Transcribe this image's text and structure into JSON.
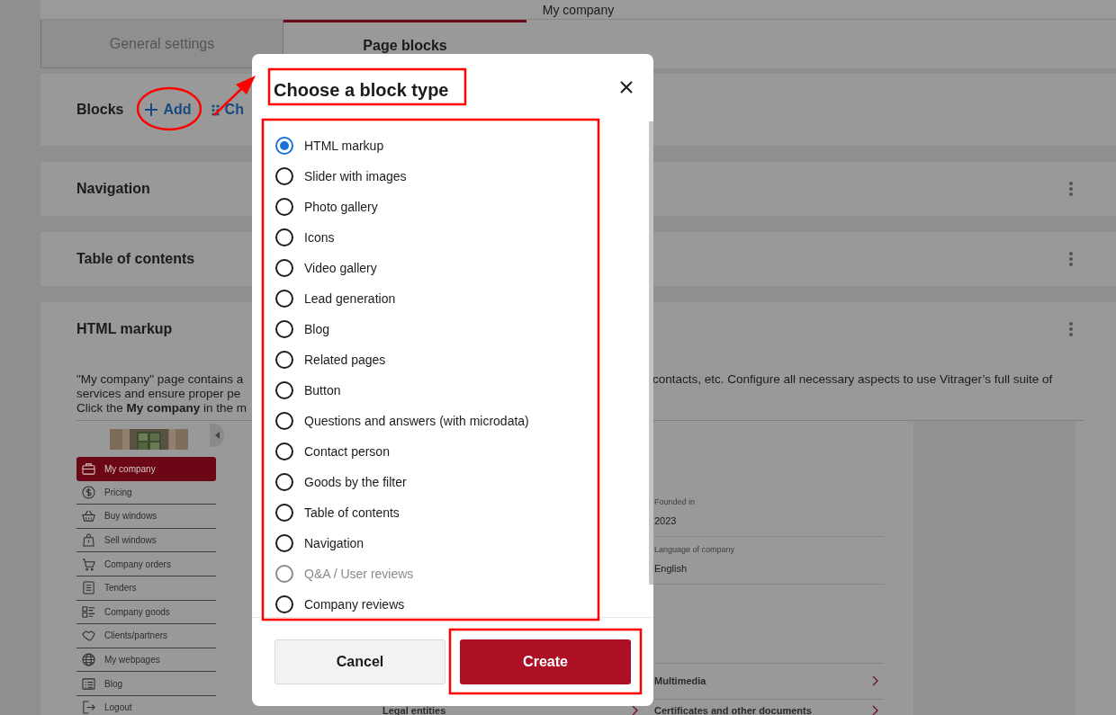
{
  "header": {
    "title": "My company"
  },
  "tabs": [
    {
      "label": "General settings",
      "selected": false
    },
    {
      "label": "Page blocks",
      "selected": true
    }
  ],
  "blocks_toolbar": {
    "title": "Blocks",
    "add_label": "Add",
    "second_action": "Ch"
  },
  "blocks": [
    {
      "title": "Navigation"
    },
    {
      "title": "Table of contents"
    },
    {
      "title": "HTML markup"
    }
  ],
  "html_block": {
    "description_left": [
      "\"My company\" page contains a",
      "services and ensure proper pe",
      "Click the **My company** in the m"
    ],
    "description_right": [
      "contacts, etc. Configure all necessary aspects to use Vitrager’s full suite of"
    ],
    "preview": {
      "menu": [
        {
          "label": "My company",
          "selected": true
        },
        {
          "label": "Pricing",
          "selected": false
        },
        {
          "label": "Buy windows",
          "selected": false
        },
        {
          "label": "Sell windows",
          "selected": false
        },
        {
          "label": "Company orders",
          "selected": false
        },
        {
          "label": "Tenders",
          "selected": false
        },
        {
          "label": "Company goods",
          "selected": false
        },
        {
          "label": "Clients/partners",
          "selected": false
        },
        {
          "label": "My webpages",
          "selected": false
        },
        {
          "label": "Blog",
          "selected": false
        },
        {
          "label": "Logout",
          "selected": false
        }
      ],
      "fields": [
        {
          "label": "Founded in",
          "value": "2023"
        },
        {
          "label": "Language of company",
          "value": "English"
        }
      ],
      "links": [
        {
          "label": "Multimedia"
        },
        {
          "label": "Certificates and other documents"
        }
      ],
      "left_links": [
        {
          "label": "Legal entities"
        }
      ]
    }
  },
  "dialog": {
    "title": "Choose a block type",
    "options": [
      {
        "label": "HTML markup",
        "selected": true,
        "disabled": false
      },
      {
        "label": "Slider with images",
        "selected": false,
        "disabled": false
      },
      {
        "label": "Photo gallery",
        "selected": false,
        "disabled": false
      },
      {
        "label": "Icons",
        "selected": false,
        "disabled": false
      },
      {
        "label": "Video gallery",
        "selected": false,
        "disabled": false
      },
      {
        "label": "Lead generation",
        "selected": false,
        "disabled": false
      },
      {
        "label": "Blog",
        "selected": false,
        "disabled": false
      },
      {
        "label": "Related pages",
        "selected": false,
        "disabled": false
      },
      {
        "label": "Button",
        "selected": false,
        "disabled": false
      },
      {
        "label": "Questions and answers (with microdata)",
        "selected": false,
        "disabled": false
      },
      {
        "label": "Contact person",
        "selected": false,
        "disabled": false
      },
      {
        "label": "Goods by the filter",
        "selected": false,
        "disabled": false
      },
      {
        "label": "Table of contents",
        "selected": false,
        "disabled": false
      },
      {
        "label": "Navigation",
        "selected": false,
        "disabled": false
      },
      {
        "label": "Q&A / User reviews",
        "selected": false,
        "disabled": true
      },
      {
        "label": "Company reviews",
        "selected": false,
        "disabled": false
      }
    ],
    "buttons": [
      {
        "label": "Cancel",
        "kind": "secondary"
      },
      {
        "label": "Create",
        "kind": "primary"
      }
    ]
  }
}
